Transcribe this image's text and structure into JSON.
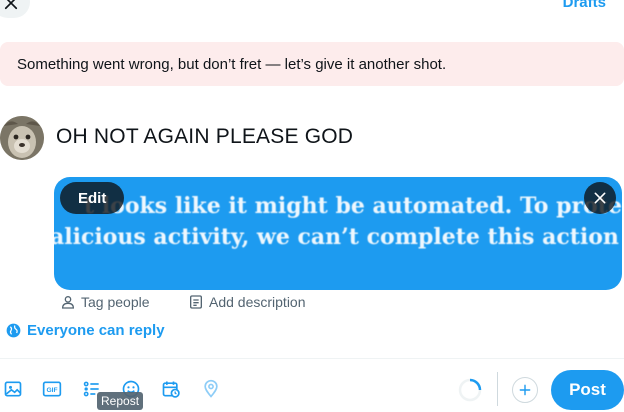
{
  "header": {
    "drafts_label": "Drafts"
  },
  "error_banner": {
    "message": "Something went wrong, but don’t fret — let’s give it another shot."
  },
  "composer": {
    "text": "OH NOT AGAIN PLEASE GOD",
    "media": {
      "edit_label": "Edit",
      "image_text_line1": "t looks like it might be automated. To protect our users from",
      "image_text_line2": "alicious activity, we can’t complete this action right now."
    },
    "tag_people_label": "Tag people",
    "add_description_label": "Add description",
    "reply_setting_label": "Everyone can reply"
  },
  "toolbar": {
    "icons": [
      "image-icon",
      "gif-icon",
      "poll-icon",
      "emoji-icon",
      "schedule-icon",
      "location-icon"
    ],
    "tooltip": "Repost",
    "post_label": "Post"
  },
  "colors": {
    "accent": "#1d9bf0",
    "error_bg": "#fdecec",
    "text_primary": "#0f1419",
    "text_secondary": "#536471"
  }
}
